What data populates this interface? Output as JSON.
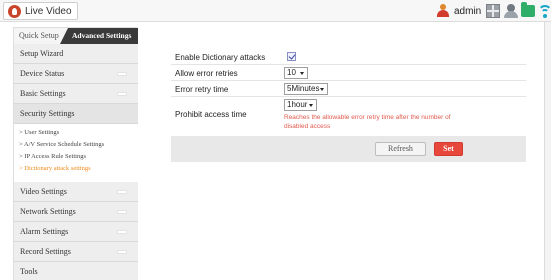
{
  "topbar": {
    "live_video_label": "Live Video",
    "username": "admin",
    "icons": [
      "grid-icon",
      "user-icon",
      "folder-icon",
      "wifi-icon"
    ]
  },
  "sidebar": {
    "tabs": {
      "quick": "Quick Setup",
      "advanced": "Advanced Settings"
    },
    "items": [
      {
        "label": "Setup Wizard"
      },
      {
        "label": "Device Status"
      },
      {
        "label": "Basic Settings"
      },
      {
        "label": "Security Settings"
      },
      {
        "label": "Video Settings"
      },
      {
        "label": "Network Settings"
      },
      {
        "label": "Alarm Settings"
      },
      {
        "label": "Record Settings"
      },
      {
        "label": "Tools"
      }
    ],
    "security_sub": [
      {
        "label": "> User Settings"
      },
      {
        "label": "> A/V Service Schedule Settings"
      },
      {
        "label": "> IP Access Rule Settings"
      },
      {
        "label": "> Dictionary attack settings",
        "active": true
      }
    ]
  },
  "form": {
    "enable_label": "Enable Dictionary attacks",
    "enable_checked": true,
    "retries_label": "Allow error retries",
    "retries_value": "10",
    "retry_time_label": "Error retry time",
    "retry_time_value": "5Minutes",
    "prohibit_label": "Prohibit access time",
    "prohibit_value": "1hour",
    "prohibit_hint": "Reaches the allowable error retry time after the number of disabled access"
  },
  "buttons": {
    "refresh": "Refresh",
    "set": "Set"
  },
  "colors": {
    "accent_orange": "#f08a1c",
    "set_red": "#e8473c",
    "hint_red": "#e05a4e",
    "tab_dark": "#3a3a3a"
  }
}
